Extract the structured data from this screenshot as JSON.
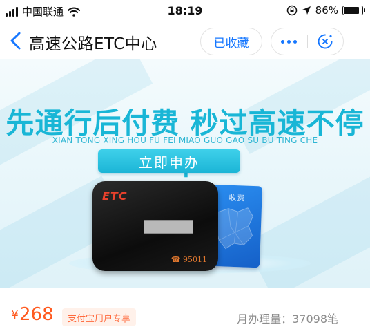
{
  "status_bar": {
    "carrier": "中国联通",
    "time": "18:19",
    "battery_percent": "86%",
    "battery_level": 0.86,
    "icons": [
      "signal-icon",
      "wifi-icon",
      "orientation-lock-icon",
      "location-icon",
      "battery-icon"
    ]
  },
  "nav": {
    "title": "高速公路ETC中心",
    "favorite_label": "已收藏",
    "icons": [
      "back-icon",
      "more-icon",
      "close-icon"
    ],
    "accent_color": "#1677ff"
  },
  "banner": {
    "headline": "先通行后付费 秒过高速不停车",
    "pinyin": "XIAN TONG XING HOU FU FEI MIAO GUO GAO SU BU TING CHE",
    "cta_label": "立即申办",
    "device_brand": "ETC",
    "device_phone": "☎ 95011",
    "card_text": "收费",
    "colors": {
      "headline": "#19b6d6",
      "cta": "#1bb5d6"
    }
  },
  "product": {
    "currency": "¥",
    "price": "268",
    "promo_tag": "支付宝用户专享",
    "monthly_volume": "月办理量：37098笔",
    "price_color": "#ff5a1f"
  }
}
